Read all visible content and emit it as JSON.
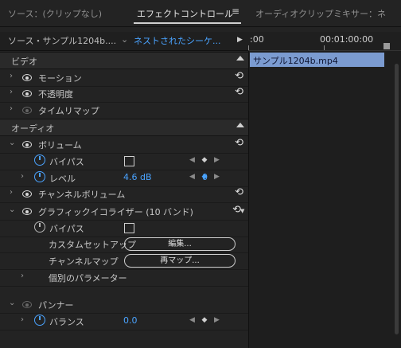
{
  "tabs": {
    "source": "ソース：(クリップなし)",
    "effect_controls": "エフェクトコントロール",
    "audio_mixer": "オーディオクリップミキサー：ネ"
  },
  "source_bar": {
    "source_label": "ソース・サンプル1204b....",
    "sequence_label": "ネストされたシーケ...",
    "ruler_start": ":00",
    "ruler_time": "00:01:00:00"
  },
  "clip": {
    "name": "サンプル1204b.mp4"
  },
  "video": {
    "header": "ビデオ",
    "motion": "モーション",
    "opacity": "不透明度",
    "time_remap": "タイムリマップ"
  },
  "audio": {
    "header": "オーディオ",
    "volume": {
      "label": "ボリューム",
      "bypass": "バイパス",
      "level_label": "レベル",
      "level_value": "4.6 dB",
      "level_kf": "0"
    },
    "channel_volume": "チャンネルボリューム",
    "graphic_eq": {
      "label": "グラフィックイコライザー (10 バンド)",
      "bypass": "バイパス",
      "custom_setup": "カスタムセットアップ",
      "edit_button": "編集...",
      "channel_map": "チャンネルマップ",
      "remap_button": "再マップ...",
      "individual_params": "個別のパラメーター"
    },
    "panner": {
      "label": "パンナー",
      "balance_label": "バランス",
      "balance_value": "0.0"
    }
  },
  "icons": {
    "reset": "reset-icon",
    "eye": "eye-icon",
    "stopwatch": "stopwatch-icon",
    "keyframe": "keyframe-diamond-icon"
  },
  "colors": {
    "accent": "#4aa3ff",
    "clip": "#7b9bd0",
    "background": "#232323"
  }
}
